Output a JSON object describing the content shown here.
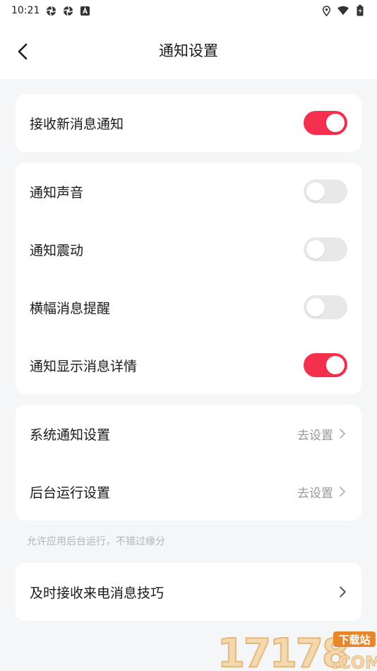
{
  "status_bar": {
    "time": "10:21",
    "left_icons": [
      "aperture-icon",
      "aperture-icon",
      "a-badge-icon"
    ],
    "right_icons": [
      "location-icon",
      "wifi-icon",
      "battery-icon"
    ]
  },
  "header": {
    "title": "通知设置",
    "back_icon": "chevron-left-icon"
  },
  "groups": [
    {
      "rows": [
        {
          "label": "接收新消息通知",
          "type": "toggle",
          "on": true
        }
      ]
    },
    {
      "rows": [
        {
          "label": "通知声音",
          "type": "toggle",
          "on": false
        },
        {
          "label": "通知震动",
          "type": "toggle",
          "on": false
        },
        {
          "label": "横幅消息提醒",
          "type": "toggle",
          "on": false
        },
        {
          "label": "通知显示消息详情",
          "type": "toggle",
          "on": true
        }
      ]
    },
    {
      "rows": [
        {
          "label": "系统通知设置",
          "type": "link",
          "value": "去设置"
        },
        {
          "label": "后台运行设置",
          "type": "link",
          "value": "去设置"
        }
      ],
      "hint": "允许应用后台运行，不错过缘分"
    },
    {
      "rows": [
        {
          "label": "及时接收来电消息技巧",
          "type": "link",
          "value": ""
        }
      ]
    }
  ],
  "watermark": {
    "text": "17178",
    "badge": "下载站",
    "suffix": ".COM"
  },
  "colors": {
    "accent": "#f5304f",
    "toggle_off": "#e8e8ea",
    "background": "#f5f6f8",
    "card": "#ffffff",
    "secondary_text": "#9a9a9a",
    "hint_text": "#b4b4b8"
  }
}
